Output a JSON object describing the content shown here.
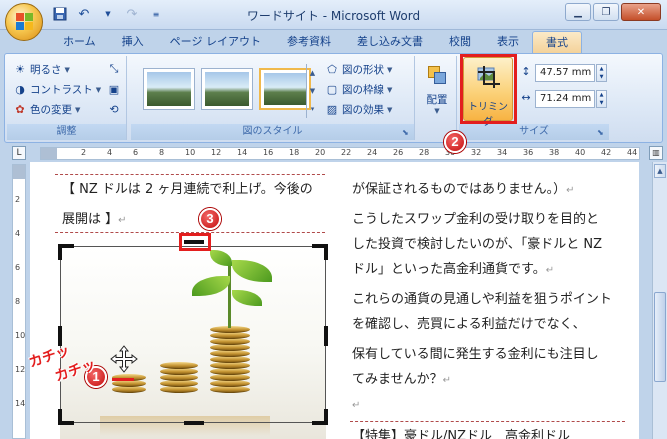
{
  "window": {
    "title": "ワードサイト - Microsoft Word"
  },
  "qat": [
    "save-icon",
    "undo-icon",
    "redo-icon",
    "customize-icon"
  ],
  "tabs": [
    {
      "label": "ホーム"
    },
    {
      "label": "挿入"
    },
    {
      "label": "ページ レイアウト"
    },
    {
      "label": "参考資料"
    },
    {
      "label": "差し込み文書"
    },
    {
      "label": "校閲"
    },
    {
      "label": "表示"
    },
    {
      "label": "書式"
    }
  ],
  "ribbon": {
    "adjust": {
      "label": "調整",
      "brightness": "明るさ",
      "contrast": "コントラスト",
      "recolor": "色の変更"
    },
    "styles": {
      "label": "図のスタイル",
      "shape": "図の形状",
      "border": "図の枠線",
      "effects": "図の効果"
    },
    "arrange": {
      "position": "配置"
    },
    "size": {
      "label": "サイズ",
      "crop": "トリミング",
      "height": "47.57 mm",
      "width": "71.24 mm"
    }
  },
  "badges": {
    "one": "1",
    "two": "2",
    "three": "3"
  },
  "document": {
    "left_line1": "【 NZ ドルは 2 ヶ月連続で利上げ。今後の",
    "left_line2": "展開は 】",
    "right_lines": [
      "が保証されるものではありません。）",
      "こうしたスワップ金利の受け取りを目的と",
      "した投資で検討したいのが、「豪ドルと NZ",
      "ドル」といった高金利通貨です。",
      "これらの通貨の見通しや利益を狙うポイント",
      "を確認し、売買による利益だけでなく、",
      "保有している間に発生する金利にも注目し",
      "てみませんか？"
    ],
    "right_bottom": "【特集】豪ドル/NZドル　高金利ドル"
  },
  "annotations": {
    "katchi1": "カチッ",
    "katchi2": "カチッ"
  },
  "ruler": {
    "h_numbers": [
      "2",
      "4",
      "6",
      "8",
      "10",
      "12",
      "14",
      "16",
      "18",
      "20",
      "22",
      "24",
      "26",
      "28",
      "30",
      "32",
      "34",
      "36",
      "38",
      "40",
      "42",
      "44"
    ],
    "v_numbers": [
      "2",
      "4",
      "6",
      "8",
      "10",
      "12",
      "14"
    ]
  },
  "colors": {
    "accent_red": "#e31e1e",
    "ribbon_blue": "#15428b",
    "crop_active": "#f7b343"
  }
}
